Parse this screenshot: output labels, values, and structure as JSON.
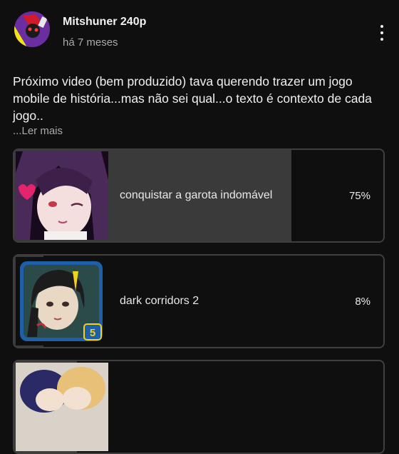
{
  "post": {
    "channel_name": "Mitshuner 240p",
    "time_ago": "há 7 meses",
    "text": "Próximo video (bem produzido) tava querendo trazer um jogo mobile de história...mas não sei qual...o texto é contexto de cada jogo..",
    "read_more": "...Ler mais",
    "menu_icon": "more-vert-icon"
  },
  "poll": {
    "options": [
      {
        "label": "conquistar a garota indomável",
        "percent_text": "75%",
        "percent": 75
      },
      {
        "label": "dark corridors 2",
        "percent_text": "8%",
        "percent": 8
      },
      {
        "label": "",
        "percent_text": "",
        "percent": 17
      }
    ]
  },
  "colors": {
    "background": "#0f0f0f",
    "poll_fill": "#3a3a3a",
    "poll_border": "#3f3f3f",
    "secondary_text": "#aaaaaa"
  }
}
